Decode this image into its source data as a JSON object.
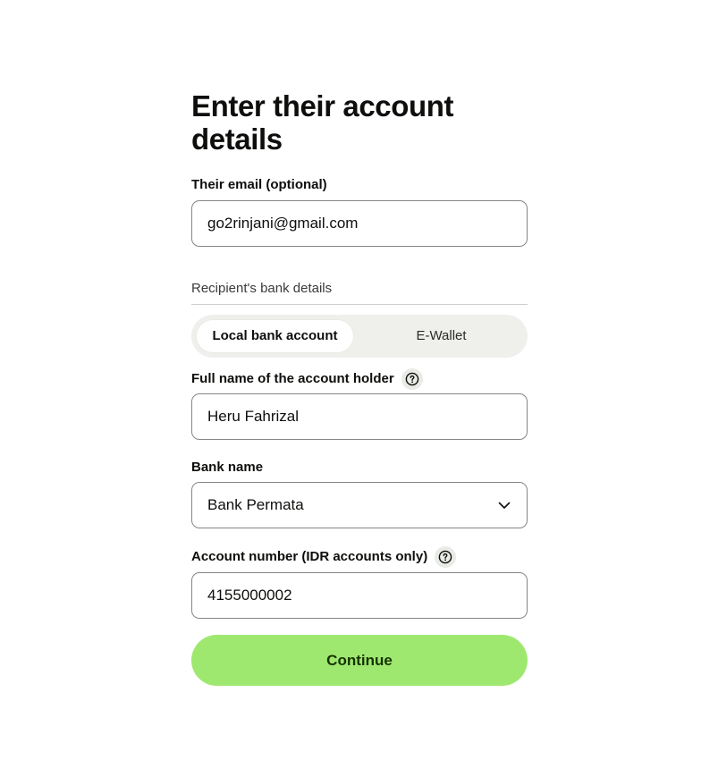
{
  "page": {
    "title": "Enter their account details"
  },
  "email": {
    "label": "Their email (optional)",
    "value": "go2rinjani@gmail.com"
  },
  "bank_details": {
    "section_label": "Recipient's bank details",
    "tabs": [
      {
        "label": "Local bank account",
        "selected": true
      },
      {
        "label": "E-Wallet",
        "selected": false
      }
    ]
  },
  "account_holder": {
    "label": "Full name of the account holder",
    "help_icon": "question-circle-icon",
    "value": "Heru Fahrizal"
  },
  "bank_name": {
    "label": "Bank name",
    "value": "Bank Permata",
    "icon": "chevron-down-icon"
  },
  "account_number": {
    "label": "Account number (IDR accounts only)",
    "help_icon": "question-circle-icon",
    "value": "4155000002"
  },
  "continue_button": {
    "label": "Continue",
    "color": "#9fe870"
  }
}
